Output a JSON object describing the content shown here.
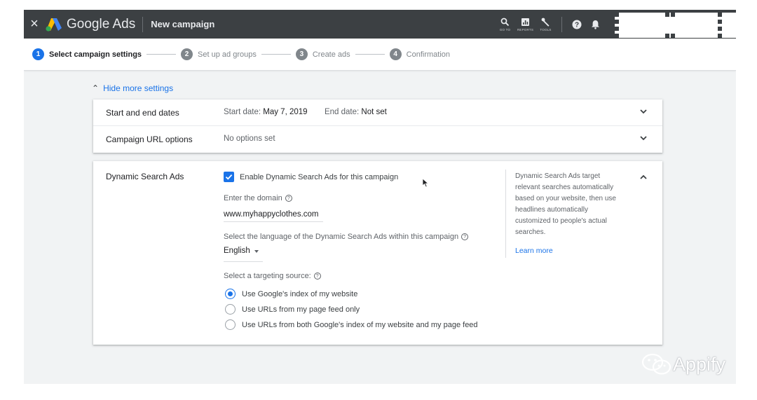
{
  "topbar": {
    "product_name": "Google Ads",
    "campaign_title": "New campaign",
    "tools": [
      {
        "label": "GO TO",
        "icon": "search-icon"
      },
      {
        "label": "REPORTS",
        "icon": "reports-icon"
      },
      {
        "label": "TOOLS",
        "icon": "wrench-icon"
      }
    ]
  },
  "stepper": {
    "steps": [
      {
        "num": "1",
        "label": "Select campaign settings",
        "active": true
      },
      {
        "num": "2",
        "label": "Set up ad groups"
      },
      {
        "num": "3",
        "label": "Create ads"
      },
      {
        "num": "4",
        "label": "Confirmation"
      }
    ]
  },
  "settings": {
    "toggle_label": "Hide more settings",
    "dates": {
      "label": "Start and end dates",
      "start_prefix": "Start date:",
      "start_value": "May 7, 2019",
      "end_prefix": "End date:",
      "end_value": "Not set"
    },
    "url_options": {
      "label": "Campaign URL options",
      "value": "No options set"
    }
  },
  "dsa": {
    "label": "Dynamic Search Ads",
    "enable_label": "Enable Dynamic Search Ads for this campaign",
    "enabled": true,
    "domain_label": "Enter the domain",
    "domain_value": "www.myhappyclothes.com",
    "language_label": "Select the language of the Dynamic Search Ads within this campaign",
    "language_value": "English",
    "targeting_label": "Select a targeting source:",
    "targeting_options": [
      {
        "label": "Use Google's index of my website",
        "selected": true
      },
      {
        "label": "Use URLs from my page feed only"
      },
      {
        "label": "Use URLs from both Google's index of my website and my page feed"
      }
    ],
    "help_text": "Dynamic Search Ads target relevant searches automatically based on your website, then use headlines automatically customized to people's actual searches.",
    "learn_more": "Learn more"
  },
  "watermark": "Appify",
  "colors": {
    "accent": "#1a73e8",
    "topbar": "#3c4043",
    "page_bg": "#f1f3f4"
  }
}
